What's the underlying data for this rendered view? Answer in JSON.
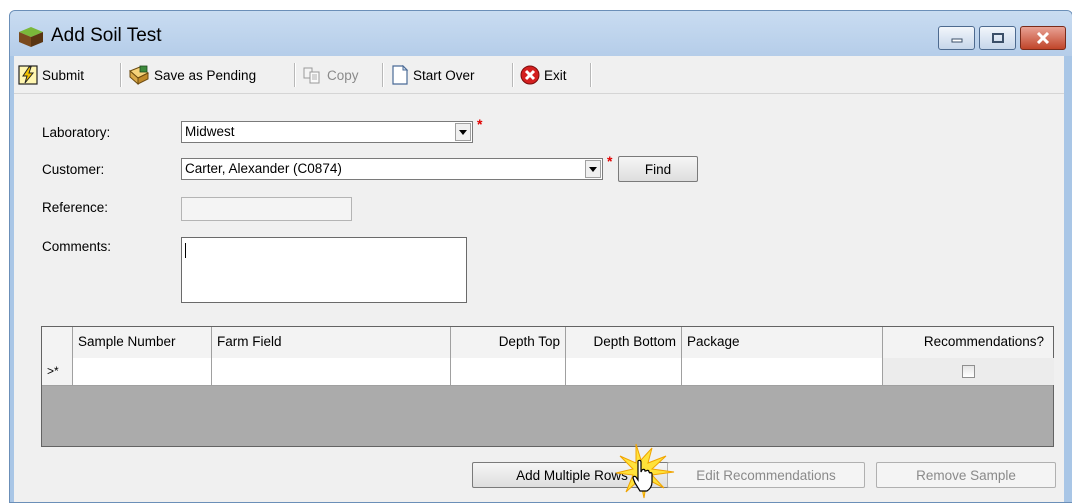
{
  "window": {
    "title": "Add Soil Test",
    "controls": [
      "minimize",
      "maximize",
      "close"
    ]
  },
  "toolbar": {
    "submit": "Submit",
    "save_pending": "Save as Pending",
    "copy": "Copy",
    "start_over": "Start Over",
    "exit": "Exit"
  },
  "form": {
    "laboratory_label": "Laboratory:",
    "laboratory_value": "Midwest",
    "customer_label": "Customer:",
    "customer_value": "Carter, Alexander (C0874)",
    "find_button": "Find",
    "reference_label": "Reference:",
    "reference_value": "",
    "comments_label": "Comments:",
    "comments_value": "",
    "required_marker": "*"
  },
  "grid": {
    "columns": [
      "Sample Number",
      "Farm Field",
      "Depth Top",
      "Depth Bottom",
      "Package",
      "Recommendations?"
    ],
    "new_row_marker": ">*",
    "rows": [
      {
        "sample_number": "",
        "farm_field": "",
        "depth_top": "",
        "depth_bottom": "",
        "package": "",
        "recommendations": false
      }
    ]
  },
  "buttons": {
    "add_multiple_rows": "Add Multiple Rows",
    "edit_recommendations": "Edit Recommendations",
    "remove_sample": "Remove Sample"
  },
  "colors": {
    "window_frame": "#a9c6e6",
    "close_button": "#c0452a",
    "required": "#e00000"
  }
}
